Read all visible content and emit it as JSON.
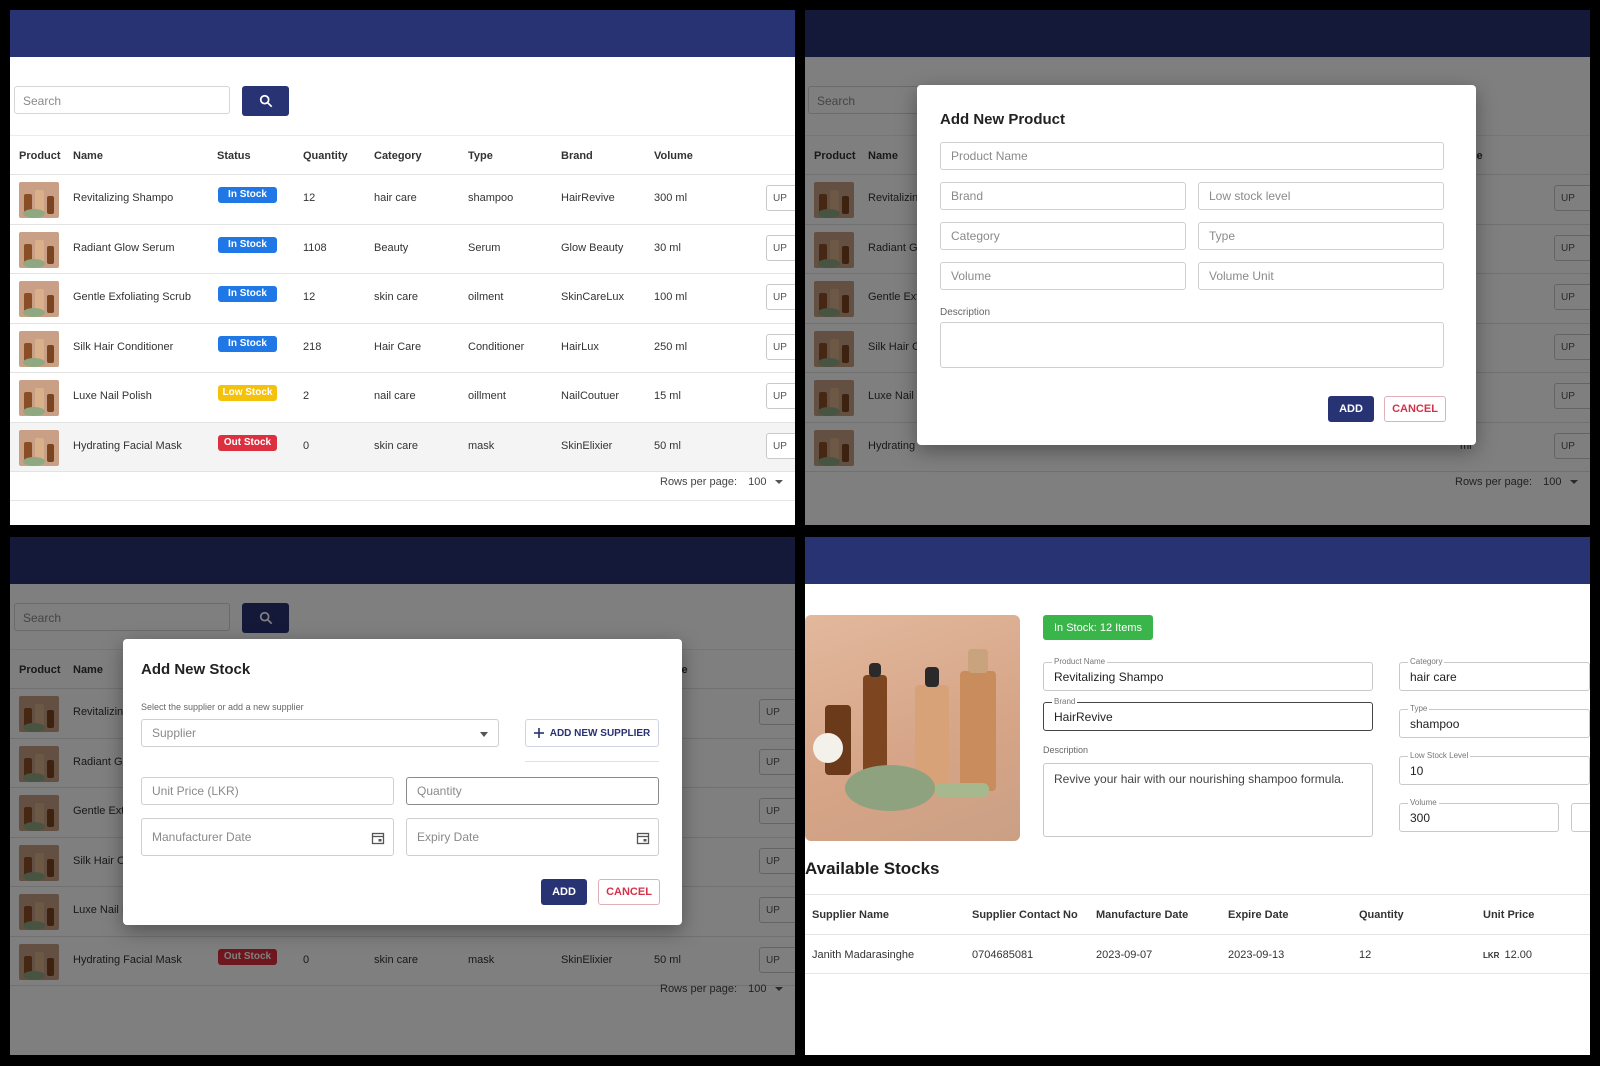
{
  "list": {
    "search_placeholder": "Search",
    "columns": [
      "Product",
      "Name",
      "Status",
      "Quantity",
      "Category",
      "Type",
      "Brand",
      "Volume"
    ],
    "rows": [
      {
        "name": "Revitalizing Shampo",
        "status": "In Stock",
        "status_kind": "in",
        "quantity": "12",
        "category": "hair care",
        "type": "shampoo",
        "brand": "HairRevive",
        "volume": "300 ml"
      },
      {
        "name": "Radiant Glow Serum",
        "status": "In Stock",
        "status_kind": "in",
        "quantity": "1108",
        "category": "Beauty",
        "type": "Serum",
        "brand": "Glow Beauty",
        "volume": "30 ml"
      },
      {
        "name": "Gentle Exfoliating Scrub",
        "status": "In Stock",
        "status_kind": "in",
        "quantity": "12",
        "category": "skin care",
        "type": "oilment",
        "brand": "SkinCareLux",
        "volume": "100 ml"
      },
      {
        "name": "Silk Hair Conditioner",
        "status": "In Stock",
        "status_kind": "in",
        "quantity": "218",
        "category": "Hair Care",
        "type": "Conditioner",
        "brand": "HairLux",
        "volume": "250 ml"
      },
      {
        "name": "Luxe Nail Polish",
        "status": "Low Stock",
        "status_kind": "low",
        "quantity": "2",
        "category": "nail care",
        "type": "oillment",
        "brand": "NailCoutuer",
        "volume": "15 ml"
      },
      {
        "name": "Hydrating Facial Mask",
        "status": "Out Stock",
        "status_kind": "out",
        "quantity": "0",
        "category": "skin care",
        "type": "mask",
        "brand": "SkinElixier",
        "volume": "50 ml"
      }
    ],
    "update_label": "UP",
    "rows_per_page_label": "Rows per page:",
    "rows_per_page_value": "100",
    "truncated_column": "ume",
    "truncated_volume": "ml",
    "truncated_names": [
      "Revitalizin",
      "Radiant Gl",
      "Gentle Ext",
      "Silk Hair C",
      "Luxe Nail I",
      "Hydrating"
    ]
  },
  "add_product_modal": {
    "title": "Add New Product",
    "product_name_placeholder": "Product Name",
    "brand_placeholder": "Brand",
    "low_stock_placeholder": "Low stock level",
    "category_placeholder": "Category",
    "type_placeholder": "Type",
    "volume_placeholder": "Volume",
    "volume_unit_placeholder": "Volume Unit",
    "description_label": "Description",
    "add_label": "ADD",
    "cancel_label": "CANCEL"
  },
  "add_stock_modal": {
    "title": "Add New Stock",
    "supplier_hint": "Select the supplier or add a new supplier",
    "supplier_placeholder": "Supplier",
    "add_supplier_label": "ADD NEW SUPPLIER",
    "unit_price_placeholder": "Unit Price (LKR)",
    "quantity_placeholder": "Quantity",
    "manufacturer_date_placeholder": "Manufacturer Date",
    "expiry_date_placeholder": "Expiry Date",
    "add_label": "ADD",
    "cancel_label": "CANCEL"
  },
  "product_detail": {
    "stock_chip": "In Stock: 12 Items",
    "product_name_label": "Product Name",
    "product_name": "Revitalizing Shampo",
    "brand_label": "Brand",
    "brand": "HairRevive",
    "description_label": "Description",
    "description": "Revive your hair with our nourishing shampoo formula.",
    "category_label": "Category",
    "category": "hair care",
    "type_label": "Type",
    "type": "shampoo",
    "low_stock_label": "Low Stock Level",
    "low_stock": "10",
    "volume_label": "Volume",
    "volume": "300",
    "stocks_title": "Available Stocks",
    "stock_columns": [
      "Supplier Name",
      "Supplier Contact No",
      "Manufacture Date",
      "Expire Date",
      "Quantity",
      "Unit Price"
    ],
    "stock_rows": [
      {
        "supplier": "Janith Madarasinghe",
        "contact": "0704685081",
        "manufacture": "2023-09-07",
        "expire": "2023-09-13",
        "quantity": "12",
        "currency": "LKR",
        "price": "12.00"
      }
    ]
  },
  "colors": {
    "navy": "#283374",
    "in_stock": "#1f78e5",
    "low_stock": "#f4c20d",
    "out_stock": "#dc2f3f",
    "stock_chip": "#39b54a"
  },
  "icons": [
    "search-icon",
    "chevron-down-icon",
    "calendar-icon",
    "plus-icon"
  ]
}
